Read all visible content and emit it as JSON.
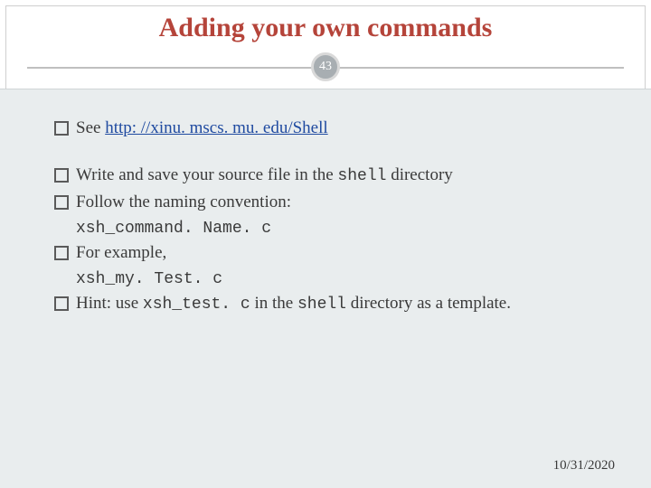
{
  "title": "Adding your own commands",
  "page_number": "43",
  "bullets": {
    "see_prefix": "See ",
    "see_link": "http: //xinu. mscs. mu. edu/Shell",
    "write_prefix": "Write and save your source file in the ",
    "write_code": "shell",
    "write_suffix": " directory",
    "follow": "Follow the naming convention:",
    "follow_sub": "xsh_command. Name. c",
    "for_example": "For example,",
    "for_example_sub": "xsh_my. Test. c",
    "hint_prefix": "Hint: use ",
    "hint_code1": "xsh_test. c",
    "hint_mid": " in the ",
    "hint_code2": "shell",
    "hint_suffix": " directory as a template."
  },
  "footer_date": "10/31/2020"
}
